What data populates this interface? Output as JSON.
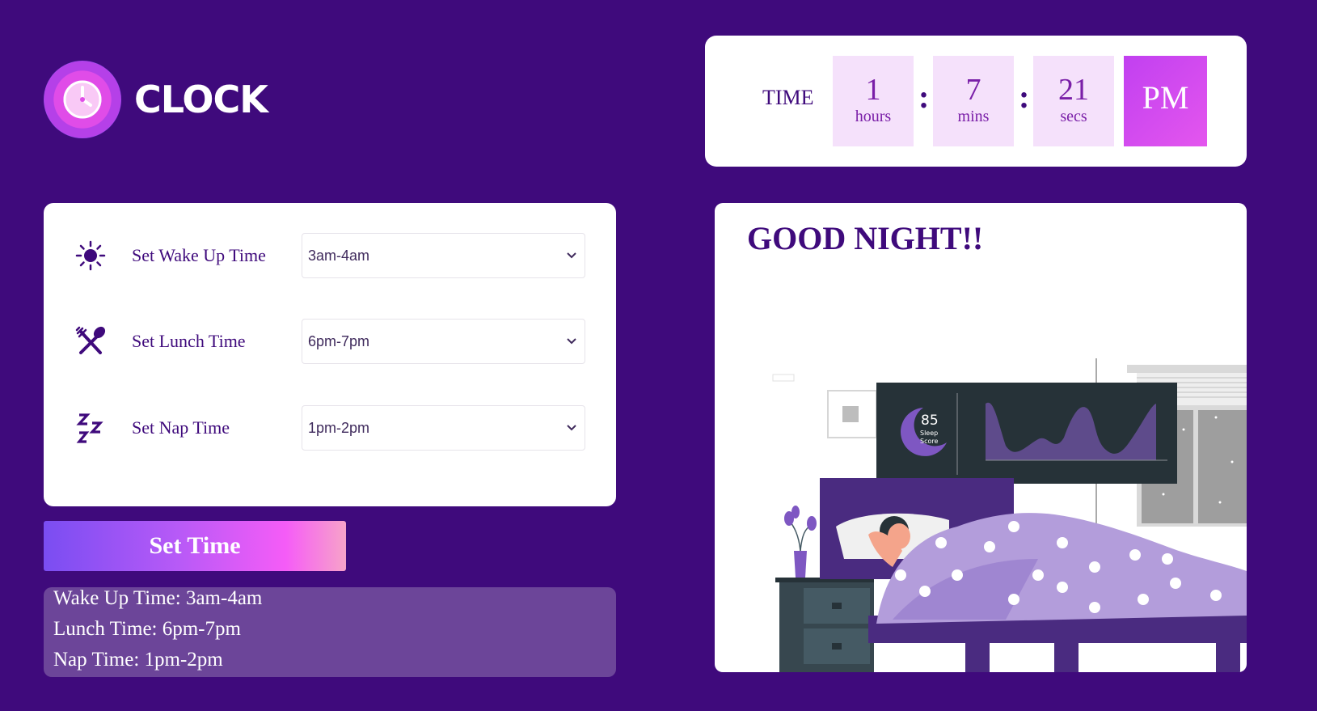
{
  "app": {
    "logo_text": "CLOCK"
  },
  "clock": {
    "label": "TIME",
    "hours": "1",
    "hours_unit": "hours",
    "minutes": "7",
    "minutes_unit": "mins",
    "seconds": "21",
    "seconds_unit": "secs",
    "separator": ":",
    "period": "PM"
  },
  "settings": {
    "wake": {
      "label": "Set Wake Up Time",
      "value": "3am-4am",
      "icon": "sun-icon"
    },
    "lunch": {
      "label": "Set Lunch Time",
      "value": "6pm-7pm",
      "icon": "fork-spoon-icon"
    },
    "nap": {
      "label": "Set Nap Time",
      "value": "1pm-2pm",
      "icon": "zzz-icon"
    }
  },
  "button": {
    "set_time": "Set Time"
  },
  "summary": {
    "wake": "Wake Up Time: 3am-4am",
    "lunch": "Lunch Time: 6pm-7pm",
    "nap": "Nap Time: 1pm-2pm"
  },
  "greeting": {
    "title": "GOOD NIGHT!!"
  },
  "illustration": {
    "score": "85",
    "score_label_1": "Sleep",
    "score_label_2": "Score"
  },
  "colors": {
    "background": "#3f0a7c",
    "accent": "#e456ee",
    "panel": "#ffffff",
    "summary_bg": "#6c4599"
  }
}
